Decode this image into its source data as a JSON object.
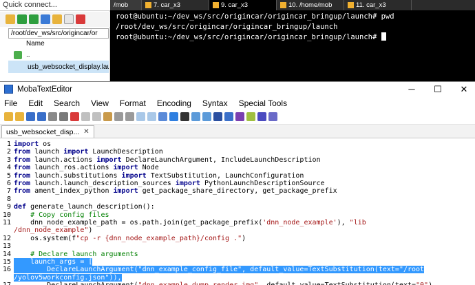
{
  "sidebar": {
    "quick_connect": "Quick connect...",
    "path": "/root/dev_ws/src/origincar/or",
    "column_name": "Name",
    "parent_dir": "..",
    "file": "usb_websocket_display.lau"
  },
  "terminal_tabs": [
    {
      "label": "/mob"
    },
    {
      "label": "7. car_x3"
    },
    {
      "label": "9. car_x3"
    },
    {
      "label": "10. /home/mob"
    },
    {
      "label": "11. car_x3"
    }
  ],
  "terminal": {
    "line1": "root@ubuntu:~/dev_ws/src/origincar/origincar_bringup/launch# pwd",
    "line2": "/root/dev_ws/src/origincar/origincar_bringup/launch",
    "line3": "root@ubuntu:~/dev_ws/src/origincar/origincar_bringup/launch# "
  },
  "editor": {
    "title": "MobaTextEditor",
    "menu": [
      "File",
      "Edit",
      "Search",
      "View",
      "Format",
      "Encoding",
      "Syntax",
      "Special Tools"
    ],
    "tab_label": "usb_websocket_disp...",
    "tab_close": "✕",
    "win_min": "─",
    "win_max": "☐",
    "win_close": "✕"
  },
  "code_lines": [
    {
      "n": "1",
      "parts": [
        [
          "kw",
          "import"
        ],
        [
          "",
          " os"
        ]
      ]
    },
    {
      "n": "2",
      "parts": [
        [
          "kw",
          "from"
        ],
        [
          "",
          " launch "
        ],
        [
          "kw",
          "import"
        ],
        [
          "",
          " LaunchDescription"
        ]
      ]
    },
    {
      "n": "3",
      "parts": [
        [
          "kw",
          "from"
        ],
        [
          "",
          " launch.actions "
        ],
        [
          "kw",
          "import"
        ],
        [
          "",
          " DeclareLaunchArgument, IncludeLaunchDescription"
        ]
      ]
    },
    {
      "n": "4",
      "parts": [
        [
          "kw",
          "from"
        ],
        [
          "",
          " launch_ros.actions "
        ],
        [
          "kw",
          "import"
        ],
        [
          "",
          " Node"
        ]
      ]
    },
    {
      "n": "5",
      "parts": [
        [
          "kw",
          "from"
        ],
        [
          "",
          " launch.substitutions "
        ],
        [
          "kw",
          "import"
        ],
        [
          "",
          " TextSubstitution, LaunchConfiguration"
        ]
      ]
    },
    {
      "n": "6",
      "parts": [
        [
          "kw",
          "from"
        ],
        [
          "",
          " launch.launch_description_sources "
        ],
        [
          "kw",
          "import"
        ],
        [
          "",
          " PythonLaunchDescriptionSource"
        ]
      ]
    },
    {
      "n": "7",
      "parts": [
        [
          "kw",
          "from"
        ],
        [
          "",
          " ament_index_python "
        ],
        [
          "kw",
          "import"
        ],
        [
          "",
          " get_package_share_directory, get_package_prefix"
        ]
      ]
    },
    {
      "n": "8",
      "parts": [
        [
          "",
          ""
        ]
      ]
    },
    {
      "n": "9",
      "parts": [
        [
          "kw",
          "def"
        ],
        [
          "",
          " generate_launch_description():"
        ]
      ]
    },
    {
      "n": "10",
      "parts": [
        [
          "",
          "    "
        ],
        [
          "cm",
          "# Copy config files"
        ]
      ]
    },
    {
      "n": "11",
      "parts": [
        [
          "",
          "    dnn_node_example_path = os.path.join(get_package_prefix("
        ],
        [
          "st",
          "'dnn_node_example'"
        ],
        [
          "",
          "), "
        ],
        [
          "st",
          "\"lib"
        ]
      ]
    },
    {
      "n": "",
      "parts": [
        [
          "st",
          "/dnn_node_example\""
        ],
        [
          "",
          ")"
        ]
      ]
    },
    {
      "n": "12",
      "parts": [
        [
          "",
          "    os.system(f"
        ],
        [
          "st",
          "\"cp -r {dnn_node_example_path}/config .\""
        ],
        [
          "",
          ")"
        ]
      ]
    },
    {
      "n": "13",
      "parts": [
        [
          "",
          ""
        ]
      ]
    },
    {
      "n": "14",
      "parts": [
        [
          "",
          "    "
        ],
        [
          "cm",
          "# Declare launch arguments"
        ]
      ]
    },
    {
      "n": "15",
      "sel": true,
      "parts": [
        [
          "",
          "    launch_args = ["
        ]
      ]
    },
    {
      "n": "16",
      "sel": true,
      "parts": [
        [
          "",
          "        DeclareLaunchArgument("
        ],
        [
          "st",
          "\"dnn_example_config_file\""
        ],
        [
          "",
          ", default_value=TextSubstitution(text="
        ],
        [
          "st",
          "\"/root"
        ]
      ]
    },
    {
      "n": "",
      "sel": true,
      "parts": [
        [
          "st",
          "/yolov5workconfig.json\""
        ],
        [
          "",
          ")),"
        ]
      ]
    },
    {
      "n": "17",
      "parts": [
        [
          "",
          "        DeclareLaunchArgument("
        ],
        [
          "st",
          "\"dnn_example_dump_render_img\""
        ],
        [
          "",
          ", default_value=TextSubstitution(text="
        ],
        [
          "st",
          "\"0\""
        ],
        [
          "",
          ")"
        ]
      ]
    }
  ],
  "colors": {
    "selection": "#3399ff",
    "keyword": "#00008b",
    "comment": "#008000",
    "string": "#a31515",
    "terminal_bg": "#000000"
  }
}
